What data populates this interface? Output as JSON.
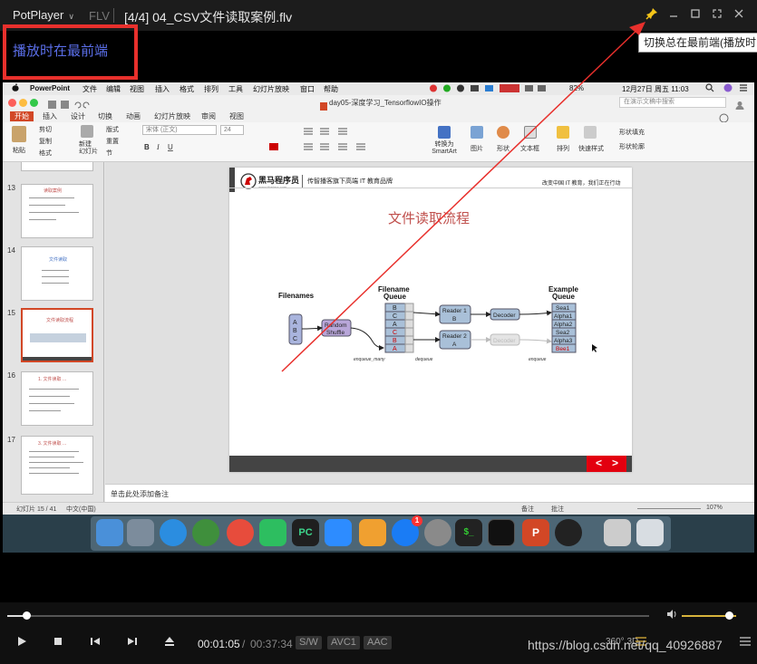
{
  "player": {
    "menu_label": "PotPlayer",
    "menu_chevron": "∨",
    "format_label": "FLV",
    "title": "[4/4] 04_CSV文件读取案例.flv",
    "pin_tooltip": "切换总在最前端(播放时...",
    "annotation": "播放时在最前端",
    "time_current": "00:01:05",
    "time_separator": "/",
    "time_total": "00:37:34",
    "tags": [
      "S/W",
      "AVC1",
      "AAC"
    ],
    "three_d": "360° 3D",
    "watermark": "https://blog.csdn.net/qq_40926887",
    "progress": 0.029,
    "volume": 0.87,
    "accent_color": "#d7b33c"
  },
  "mac_menu": {
    "app": "PowerPoint",
    "items": [
      "文件",
      "编辑",
      "视图",
      "插入",
      "格式",
      "排列",
      "工具",
      "幻灯片放映",
      "窗口",
      "帮助"
    ],
    "battery": "82%",
    "datetime": "12月27日 周五 11:03"
  },
  "ppt": {
    "window_title": "day05-深度学习_TensorflowIO操作",
    "search_placeholder": "在演示文稿中搜索",
    "tabs": [
      "开始",
      "插入",
      "设计",
      "切换",
      "动画",
      "幻灯片放映",
      "审阅",
      "视图"
    ],
    "ribbon": {
      "paste": "粘贴",
      "cut": "剪切",
      "copy": "复制",
      "format": "格式",
      "new_slide": "新建\n幻灯片",
      "layout": "版式",
      "reset": "重置",
      "section": "节",
      "font_name": "宋体 (正文)",
      "font_size": "24",
      "convert_smartart": "转换为\nSmartArt",
      "picture": "图片",
      "shape": "形状",
      "textbox": "文本框",
      "arrange": "排列",
      "quick_styles": "快速样式",
      "shape_fill": "形状填充",
      "shape_outline": "形状轮廓"
    },
    "thumbnails": [
      {
        "num": "13",
        "title": "读取案例"
      },
      {
        "num": "14",
        "title": "文件读取"
      },
      {
        "num": "15",
        "title": "文件读取流程"
      },
      {
        "num": "16",
        "title": "1. 文件读取 ..."
      },
      {
        "num": "17",
        "title": "3. 文件读取 ..."
      }
    ],
    "notes_placeholder": "单击此处添加备注",
    "status": {
      "slide_of": "幻灯片 15 / 41",
      "language": "中文(中国)",
      "notes": "备注",
      "comments": "批注",
      "zoom": "107%"
    }
  },
  "slide": {
    "brand_name": "黑马程序员",
    "brand_url": "www.itheima.com",
    "brand_slogan": "传智播客旗下高端 IT 教育品牌",
    "header_right": "改变中国 IT 教育，我们正在行动",
    "title": "文件读取流程",
    "title_color": "#c0504d",
    "labels": {
      "filenames": "Filenames",
      "filename_queue": "Filename\nQueue",
      "example_queue": "Example\nQueue",
      "random_shuffle": "Random\nShuffle",
      "reader1": "Reader 1\nB",
      "reader2": "Reader 2\nA",
      "decoder": "Decoder",
      "enqueue_many": "enqueue_many",
      "dequeue": "dequeue",
      "enqueue": "enqueue"
    },
    "filenames": [
      "A",
      "B",
      "C"
    ],
    "filename_queue": [
      "B",
      "C",
      "A",
      "C",
      "B",
      "A"
    ],
    "example_queue": [
      "Sea1",
      "Alpha1",
      "Alpha2",
      "Sea2",
      "Alpha3",
      "Bee1"
    ],
    "nav_prev": "<",
    "nav_next": ">"
  },
  "dock": {
    "apps": [
      "finder-icon",
      "launchpad-icon",
      "safari-icon",
      "atom-icon",
      "chrome-icon",
      "evernote-icon",
      "pycharm-icon",
      "zoom-icon",
      "keynote-icon",
      "app-store-icon",
      "system-preferences-icon",
      "terminal-icon",
      "activity-monitor-icon",
      "powerpoint-icon",
      "obs-icon",
      "archive-icon",
      "trash-icon"
    ],
    "badge": "1"
  }
}
